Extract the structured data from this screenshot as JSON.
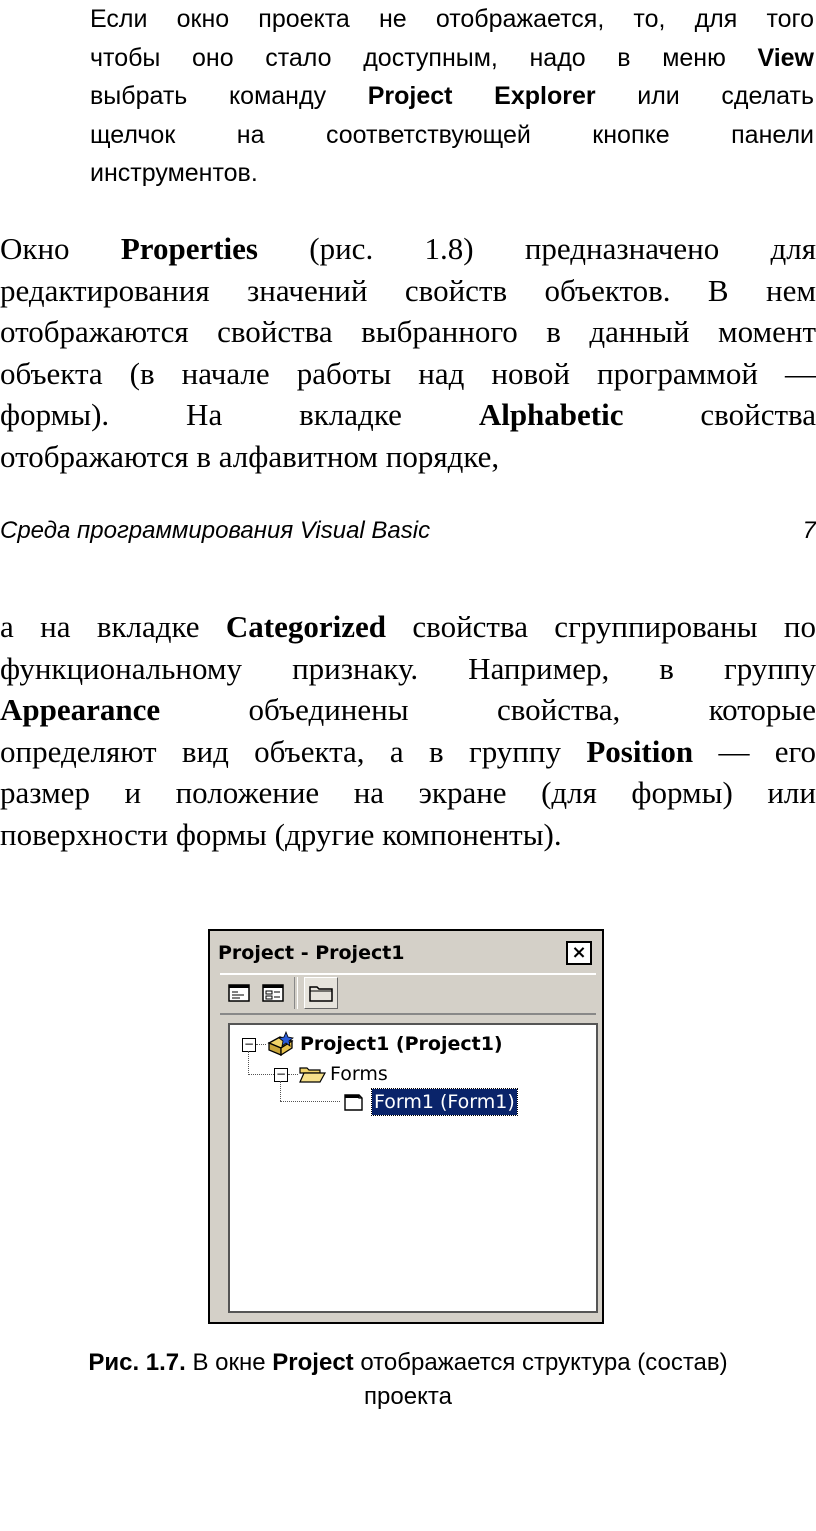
{
  "note": {
    "l1": "Если окно проекта не отображается, то, для того",
    "l2_a": "чтобы оно стало доступным, надо в меню ",
    "l2_b": "View",
    "l3_a": "выбрать команду ",
    "l3_b": "Project Explorer",
    "l3_c": " или сделать",
    "l4": "щелчок на соответствующей кнопке панели",
    "l5": "инструментов."
  },
  "para1": {
    "l1_a": "Окно ",
    "l1_b": "Properties",
    "l1_c": " (рис. 1.8) предназначено для",
    "l2": "редактирования значений свойств объектов. В нем",
    "l3": "отображаются свойства выбранного в данный момент",
    "l4": "объекта (в начале работы над новой программой —",
    "l5_a": "формы). На вкладке ",
    "l5_b": "Alphabetic",
    "l5_c": " свойства",
    "l6": "отображаются в алфавитном порядке,"
  },
  "running_header": {
    "title": "Среда программирования Visual Basic",
    "page_number": "7"
  },
  "para2": {
    "l1_a": "а на вкладке ",
    "l1_b": "Categorized",
    "l1_c": " свойства сгруппированы по",
    "l2": "функциональному признаку. Например, в группу",
    "l3_a": "Appearance",
    "l3_b": " объединены свойства, которые",
    "l4_a": "определяют вид объекта, а в группу ",
    "l4_b": "Position",
    "l4_c": " — его",
    "l5": "размер и положение на экране (для формы) или",
    "l6": "поверхности формы (другие компоненты)."
  },
  "window": {
    "title": "Project - Project1",
    "close_glyph": "×",
    "toolbar": [
      "view-code-icon",
      "view-object-icon",
      "toggle-folders-icon"
    ],
    "tree": {
      "root_label": "Project1 (Project1)",
      "folder_label": "Forms",
      "item_label": "Form1 (Form1)",
      "expander_glyph": "−"
    },
    "colors": {
      "chrome": "#d4d0c8",
      "selection": "#0a246a"
    }
  },
  "caption": {
    "label": "Рис. 1.7.",
    "text_a": " В окне ",
    "text_b": "Project",
    "text_c": " отображается структура (состав)",
    "line2": "проекта"
  }
}
